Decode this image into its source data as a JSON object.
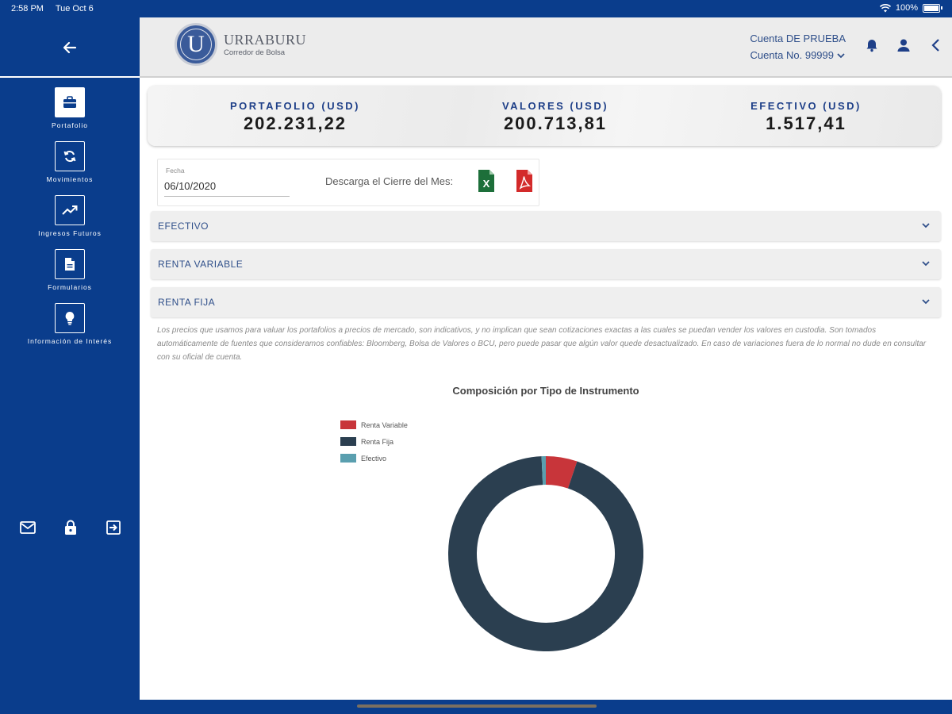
{
  "status_bar": {
    "time": "2:58 PM",
    "date": "Tue Oct 6",
    "battery": "100%"
  },
  "sidebar": {
    "items": [
      {
        "label": "Portafolio",
        "icon": "briefcase-icon",
        "active": true
      },
      {
        "label": "Movimientos",
        "icon": "refresh-icon",
        "active": false
      },
      {
        "label": "Ingresos Futuros",
        "icon": "trending-up-icon",
        "active": false
      },
      {
        "label": "Formularios",
        "icon": "document-icon",
        "active": false
      },
      {
        "label": "Información de Interés",
        "icon": "lightbulb-icon",
        "active": false
      }
    ],
    "actions": [
      "mail-icon",
      "lock-icon",
      "logout-icon"
    ]
  },
  "header": {
    "logo_letter": "U",
    "logo_name": "URRABURU",
    "logo_sub": "Corredor de Bolsa",
    "account_name": "Cuenta DE PRUEBA",
    "account_number": "Cuenta No. 99999"
  },
  "summary": {
    "portfolio_label": "PORTAFOLIO (USD)",
    "portfolio_value": "202.231,22",
    "securities_label": "VALORES (USD)",
    "securities_value": "200.713,81",
    "cash_label": "EFECTIVO (USD)",
    "cash_value": "1.517,41"
  },
  "date_panel": {
    "label": "Fecha",
    "value": "06/10/2020",
    "download_label": "Descarga el Cierre del Mes:",
    "xls_letter": "X"
  },
  "sections": [
    "EFECTIVO",
    "RENTA VARIABLE",
    "RENTA FIJA"
  ],
  "disclaimer": "Los precios que usamos para valuar los portafolios a precios de mercado, son indicativos, y no implican que sean cotizaciones exactas a las cuales se puedan vender los valores en custodia. Son tomados automáticamente de fuentes que consideramos confiables: Bloomberg, Bolsa de Valores o BCU, pero puede pasar que algún valor quede desactualizado. En caso de variaciones fuera de lo normal no dude en consultar con su oficial de cuenta.",
  "chart_data": {
    "type": "pie",
    "title": "Composición por Tipo de Instrumento",
    "legend_position": "top-left",
    "series": [
      {
        "name": "Renta Variable",
        "value": 5.2,
        "color": "#c8353a"
      },
      {
        "name": "Renta Fija",
        "value": 94.1,
        "color": "#2b3f50"
      },
      {
        "name": "Efectivo",
        "value": 0.7,
        "color": "#5a9faf"
      }
    ]
  },
  "colors": {
    "brand_blue": "#0a3d8c",
    "label_blue": "#1e3f88"
  }
}
